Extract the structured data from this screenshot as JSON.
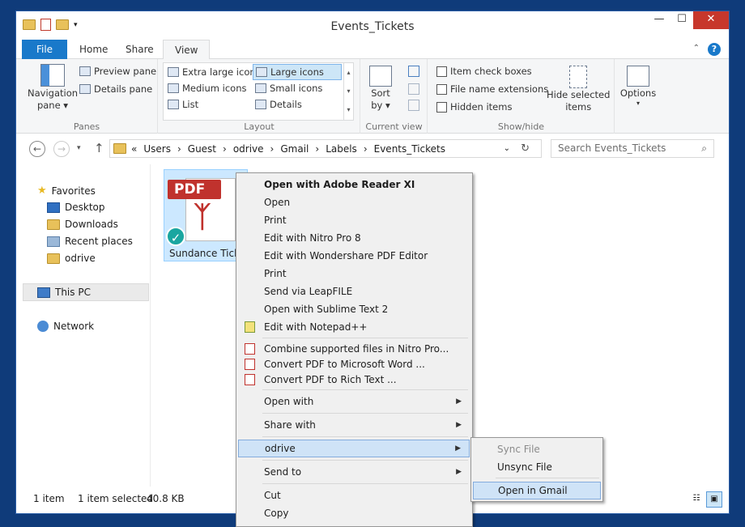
{
  "window": {
    "title": "Events_Tickets"
  },
  "controls": {
    "minimize": "—",
    "maximize": "☐",
    "close": "✕"
  },
  "tabs": [
    "File",
    "Home",
    "Share",
    "View"
  ],
  "ribbon": {
    "panes": {
      "nav_pane_line1": "Navigation",
      "nav_pane_line2": "pane",
      "preview": "Preview pane",
      "details": "Details pane",
      "label": "Panes"
    },
    "layout": {
      "items": [
        "Extra large icons",
        "Large icons",
        "Medium icons",
        "Small icons",
        "List",
        "Details"
      ],
      "selected": "Large icons",
      "label": "Layout"
    },
    "current_view": {
      "sort_line1": "Sort",
      "sort_line2": "by",
      "label": "Current view"
    },
    "show_hide": {
      "item_check_boxes": "Item check boxes",
      "file_name_extensions": "File name extensions",
      "hidden_items": "Hidden items",
      "hide_selected_line1": "Hide selected",
      "hide_selected_line2": "items",
      "label": "Show/hide"
    },
    "options": "Options"
  },
  "address": {
    "crumbs": [
      "«",
      "Users",
      "Guest",
      "odrive",
      "Gmail",
      "Labels",
      "Events_Tickets"
    ],
    "search_placeholder": "Search Events_Tickets"
  },
  "nav": {
    "favorites": "Favorites",
    "desktop": "Desktop",
    "downloads": "Downloads",
    "recent": "Recent places",
    "odrive": "odrive",
    "this_pc": "This PC",
    "network": "Network"
  },
  "file": {
    "name": "Sundance Tickets",
    "badge": "PDF"
  },
  "status": {
    "count": "1 item",
    "selected": "1 item selected",
    "size": "40.8 KB"
  },
  "context_menu": [
    "Open with Adobe Reader XI",
    "Open",
    "Print",
    "Edit with Nitro Pro 8",
    "Edit with Wondershare PDF Editor",
    "Print",
    "Send via LeapFILE",
    "Open with Sublime Text 2",
    "Edit with Notepad++",
    "Combine supported files in Nitro Pro...",
    "Convert PDF to Microsoft Word ...",
    "Convert PDF to Rich Text ...",
    "Open with",
    "Share with",
    "odrive",
    "Send to",
    "Cut",
    "Copy"
  ],
  "submenu": [
    "Sync File",
    "Unsync File",
    "Open in Gmail"
  ],
  "colors": {
    "accent": "#1979ca",
    "close": "#c7372c",
    "highlight": "#cfe3f7",
    "desktop_bg": "#0f3b7a"
  }
}
